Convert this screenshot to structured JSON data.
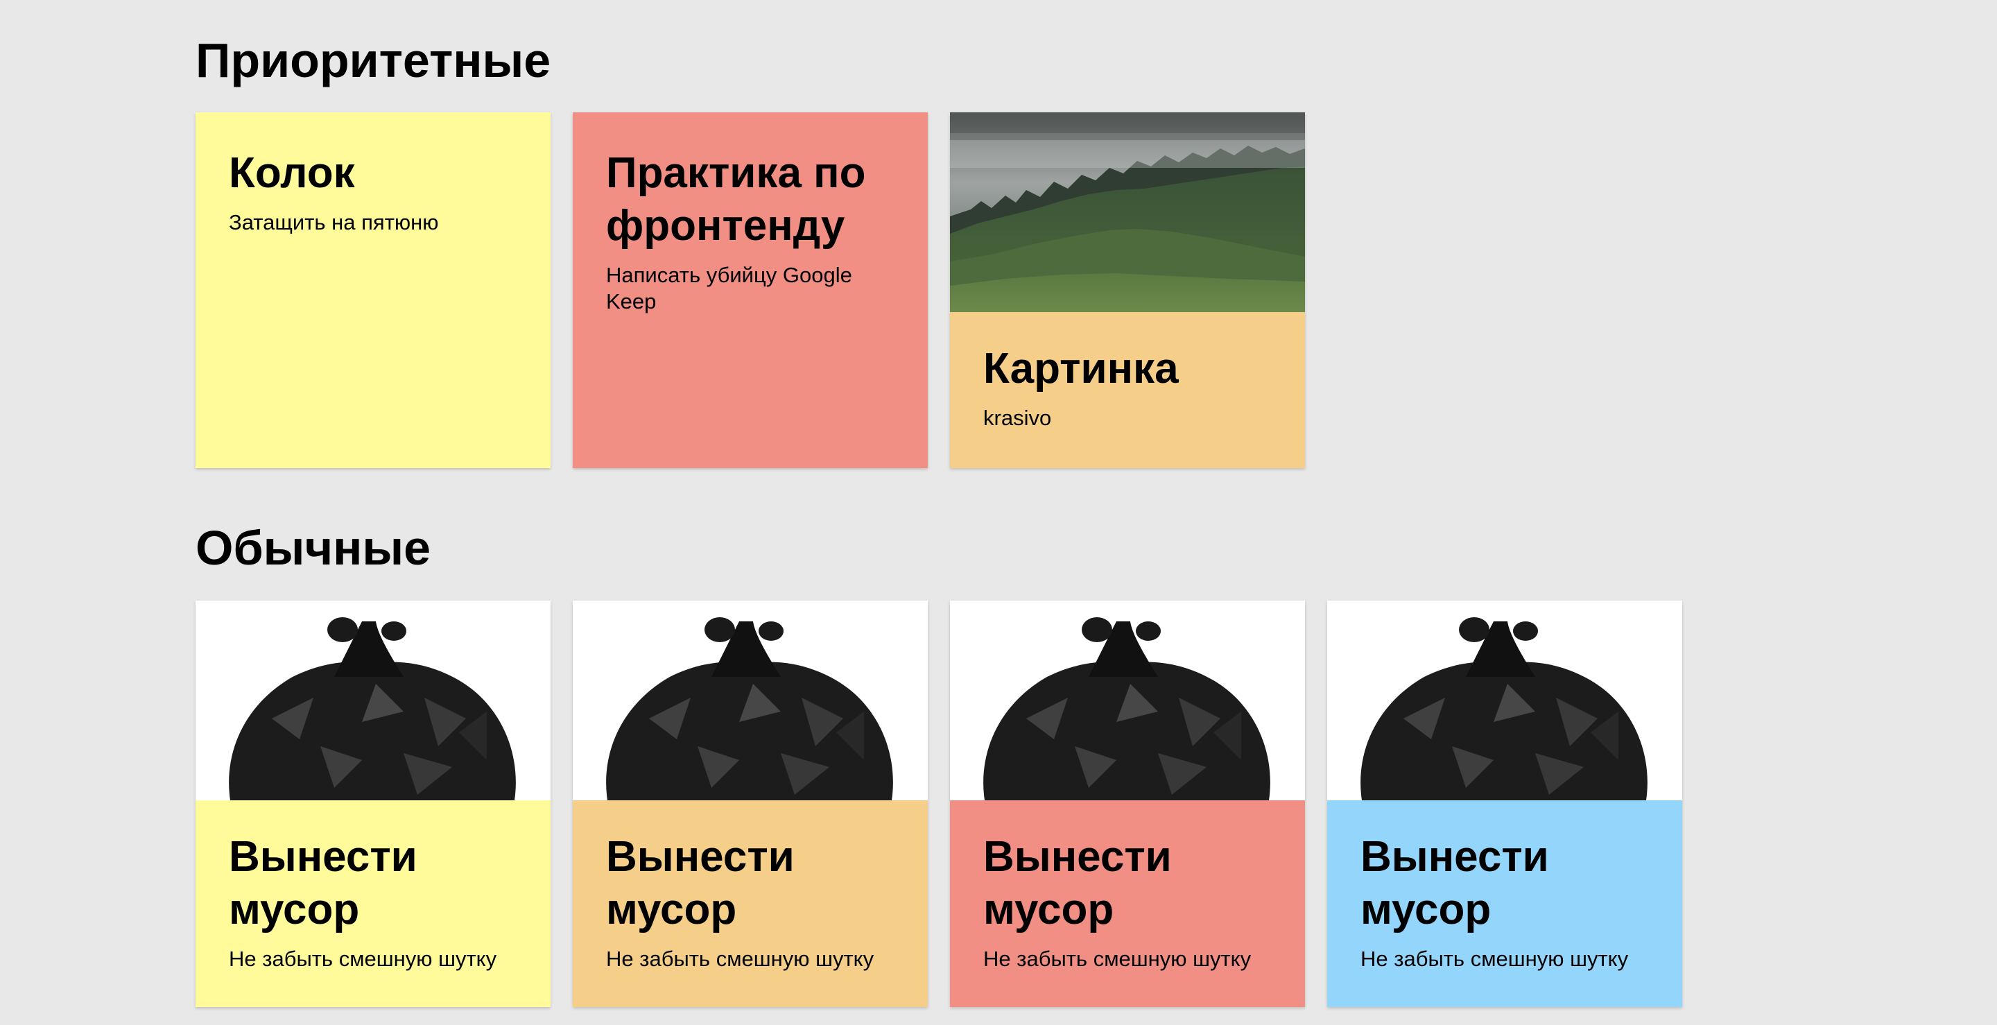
{
  "sections": {
    "priority": {
      "title": "Приоритетные",
      "cards": [
        {
          "title": "Колок",
          "text": "Затащить на пятюню",
          "color": "#fffb9a"
        },
        {
          "title": "Практика по фронтенду",
          "text": "Написать убийцу Google Keep",
          "color": "#f28f84"
        },
        {
          "title": "Картинка",
          "text": "krasivo",
          "color": "#f5cf8a",
          "image": "misty-forest-hill-photo"
        }
      ]
    },
    "regular": {
      "title": "Обычные",
      "cards": [
        {
          "title": "Вынести мусор",
          "text": "Не забыть смешную шутку",
          "color": "#fffb9a",
          "image": "black-trash-bag-photo"
        },
        {
          "title": "Вынести мусор",
          "text": "Не забыть смешную шутку",
          "color": "#f5cf8a",
          "image": "black-trash-bag-photo"
        },
        {
          "title": "Вынести мусор",
          "text": "Не забыть смешную шутку",
          "color": "#f28f84",
          "image": "black-trash-bag-photo"
        },
        {
          "title": "Вынести мусор",
          "text": "Не забыть смешную шутку",
          "color": "#94d6fb",
          "image": "black-trash-bag-photo"
        }
      ]
    }
  },
  "colors": {
    "background": "#e8e8e8",
    "yellow": "#fffb9a",
    "red": "#f28f84",
    "orange": "#f5cf8a",
    "blue": "#94d6fb"
  }
}
